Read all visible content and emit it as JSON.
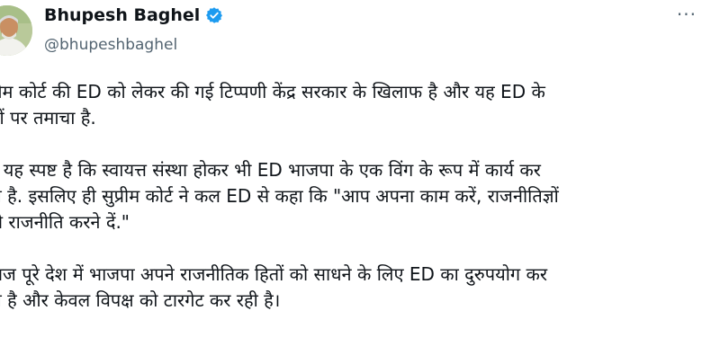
{
  "author": {
    "display_name": "Bhupesh Baghel",
    "handle": "@bhupeshbaghel",
    "verified": true,
    "verified_color": "#1d9bf0",
    "avatar_icon": "profile-photo"
  },
  "more_icon": "more-options-icon",
  "tweet": {
    "paragraphs": [
      {
        "lines": [
          "प्रीम कोर्ट की ED को लेकर की गई टिप्पणी केंद्र सरकार के खिलाफ है और यह ED के",
          "लों पर तमाचा है."
        ]
      },
      {
        "lines": [
          "ब यह स्पष्ट है कि स्वायत्त संस्था होकर भी ED भाजपा के एक विंग के रूप में कार्य कर",
          "ही है. इसलिए ही सुप्रीम कोर्ट ने कल ED से कहा कि \"आप अपना काम करें, राजनीतिज्ञों",
          "ो राजनीति करने दें.\""
        ]
      },
      {
        "lines": [
          "ाज पूरे देश में भाजपा अपने राजनीतिक हितों को साधने के लिए ED का दुरुपयोग कर",
          "ही है और केवल विपक्ष को टारगेट कर रही है।"
        ]
      }
    ]
  }
}
